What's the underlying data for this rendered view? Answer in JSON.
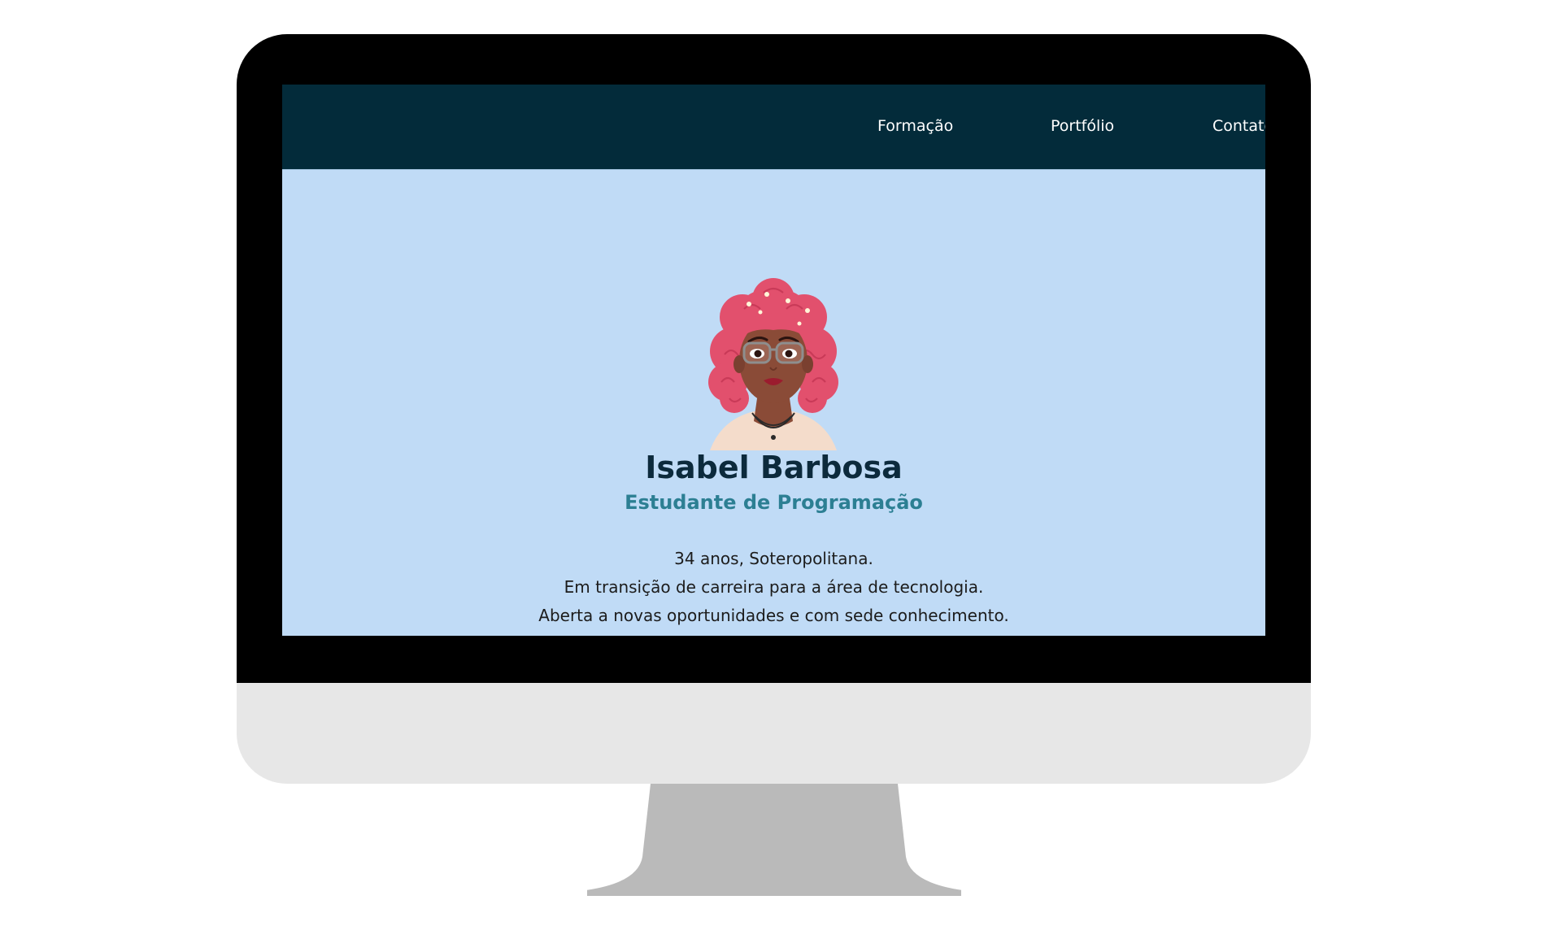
{
  "nav": {
    "items": [
      {
        "label": "Formação"
      },
      {
        "label": "Portfólio"
      },
      {
        "label": "Contato"
      }
    ]
  },
  "profile": {
    "name": "Isabel Barbosa",
    "role": "Estudante de Programação",
    "bio_lines": [
      "34 anos, Soteropolitana.",
      "Em transição de carreira para a área de tecnologia.",
      "Aberta a novas oportunidades e com sede conhecimento."
    ]
  },
  "colors": {
    "navbar": "#032b3a",
    "page_background": "#c0dbf6",
    "name": "#0c2a3c",
    "role": "#2c7f93",
    "monitor_bezel": "#000000",
    "monitor_chin": "#e7e7e7",
    "monitor_stand": "#bababa"
  },
  "icons": {
    "avatar": "avatar-illustration"
  }
}
